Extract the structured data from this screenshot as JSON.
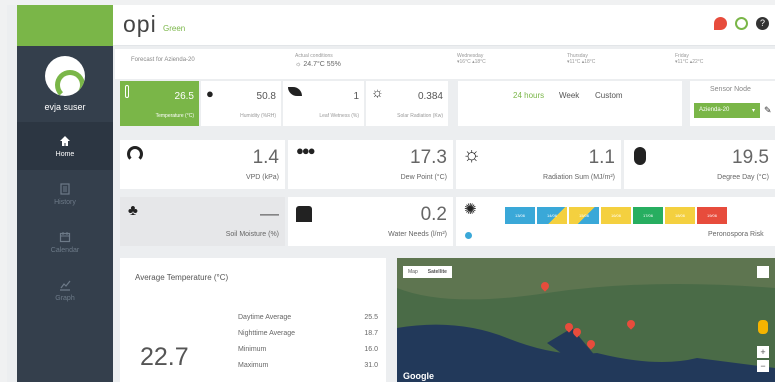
{
  "app": {
    "logo": "opi",
    "logo_sub": "Green",
    "user": "evja suser"
  },
  "nav": [
    {
      "label": "Home",
      "active": true
    },
    {
      "label": "History"
    },
    {
      "label": "Calendar"
    },
    {
      "label": "Graph"
    }
  ],
  "forecast": {
    "title": "Forecast for Azienda-20",
    "actual_label": "Actual conditions",
    "actual_value": "24.7°C 55%",
    "days": [
      {
        "day": "Wednesday",
        "temps": "▾16°C ▴18°C"
      },
      {
        "day": "Thursday",
        "temps": "▾11°C ▴18°C"
      },
      {
        "day": "Friday",
        "temps": "▾11°C ▴22°C"
      }
    ]
  },
  "sensors": [
    {
      "value": "26.5",
      "label": "Temperature (°C)"
    },
    {
      "value": "50.8",
      "label": "Humidity (%RH)"
    },
    {
      "value": "1",
      "label": "Leaf Wetness (%)"
    },
    {
      "value": "0.384",
      "label": "Solar Radiation (Kw)"
    }
  ],
  "range": {
    "h24": "24 hours",
    "week": "Week",
    "custom": "Custom"
  },
  "sensor_node": {
    "title": "Sensor Node",
    "value": "Azienda-20"
  },
  "metrics": [
    {
      "value": "1.4",
      "label": "VPD (kPa)"
    },
    {
      "value": "17.3",
      "label": "Dew Point (°C)"
    },
    {
      "value": "1.1",
      "label": "Radiation Sum (MJ/m²)"
    },
    {
      "value": "19.5",
      "label": "Degree Day (°C)"
    },
    {
      "value": "—",
      "label": "Soil Moisture (%)"
    },
    {
      "value": "0.2",
      "label": "Water Needs (l/m²)"
    }
  ],
  "perono": {
    "label": "Peronospora Risk",
    "cells": [
      "13/06",
      "14/06",
      "15/06",
      "16/06",
      "17/06",
      "18/06",
      "19/06"
    ]
  },
  "avg": {
    "title": "Average Temperature (°C)",
    "value": "22.7",
    "rows": [
      {
        "k": "Daytime Average",
        "v": "25.5"
      },
      {
        "k": "Nighttime Average",
        "v": "18.7"
      },
      {
        "k": "Minimum",
        "v": "16.0"
      },
      {
        "k": "Maximum",
        "v": "31.0"
      }
    ]
  },
  "map": {
    "tab_map": "Map",
    "tab_sat": "Satellite",
    "logo": "Google"
  }
}
